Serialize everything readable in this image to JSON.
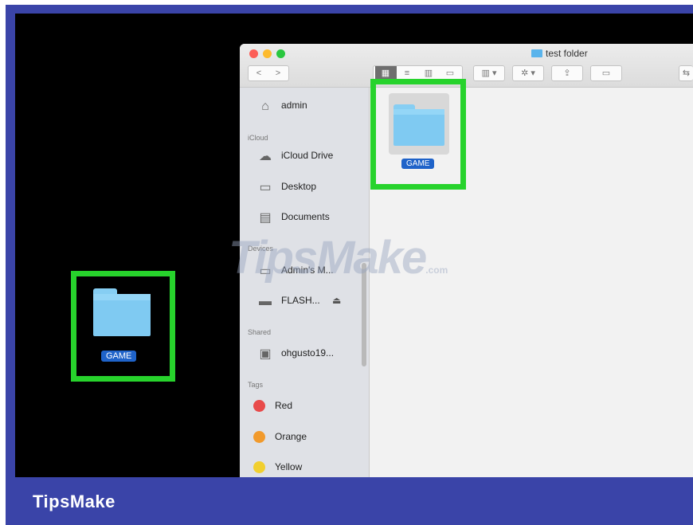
{
  "brand": "TipsMake",
  "watermark": {
    "main": "TipsMake",
    "suffix": ".com"
  },
  "desktop": {
    "folder_name": "GAME",
    "folder_icon": "folder-icon"
  },
  "window": {
    "title": "test folder",
    "toolbar": {
      "back": "<",
      "forward": ">",
      "view_icons": [
        "grid-view-icon",
        "list-view-icon",
        "column-view-icon",
        "cover-flow-icon"
      ],
      "arrange": "▥ ▾",
      "action": "✲ ▾",
      "share": "⇪",
      "tag": "▭",
      "extra": "⇆"
    },
    "sidebar": {
      "favorites": [
        {
          "label": "admin",
          "icon": "home-icon"
        }
      ],
      "icloud_header": "iCloud",
      "icloud": [
        {
          "label": "iCloud Drive",
          "icon": "cloud-icon"
        },
        {
          "label": "Desktop",
          "icon": "desktop-icon"
        },
        {
          "label": "Documents",
          "icon": "document-icon"
        }
      ],
      "devices_header": "Devices",
      "devices": [
        {
          "label": "Admin's M...",
          "icon": "laptop-icon"
        },
        {
          "label": "FLASH...",
          "icon": "drive-icon",
          "eject": "⏏"
        }
      ],
      "shared_header": "Shared",
      "shared": [
        {
          "label": "ohgusto19...",
          "icon": "monitor-icon"
        }
      ],
      "tags_header": "Tags",
      "tags": [
        {
          "label": "Red",
          "color": "#e84a4a"
        },
        {
          "label": "Orange",
          "color": "#f19a2c"
        },
        {
          "label": "Yellow",
          "color": "#f1cf2f"
        }
      ]
    },
    "content": {
      "selected_item": "GAME"
    }
  },
  "colors": {
    "highlight": "#27d32c",
    "frame": "#3a44a8",
    "selection": "#1f63c9"
  }
}
